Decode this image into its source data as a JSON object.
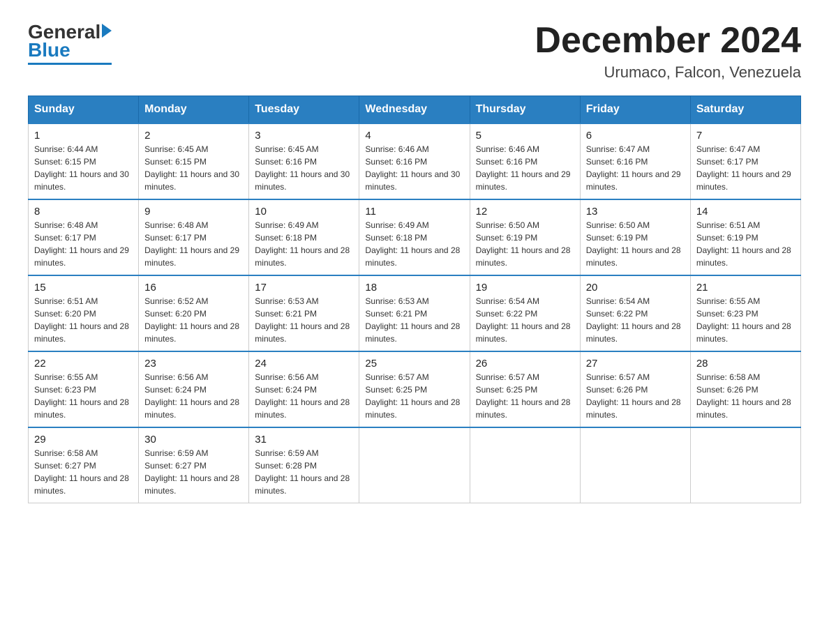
{
  "logo": {
    "general": "General",
    "blue": "Blue"
  },
  "title": "December 2024",
  "location": "Urumaco, Falcon, Venezuela",
  "headers": [
    "Sunday",
    "Monday",
    "Tuesday",
    "Wednesday",
    "Thursday",
    "Friday",
    "Saturday"
  ],
  "weeks": [
    [
      {
        "day": "1",
        "sunrise": "6:44 AM",
        "sunset": "6:15 PM",
        "daylight": "11 hours and 30 minutes."
      },
      {
        "day": "2",
        "sunrise": "6:45 AM",
        "sunset": "6:15 PM",
        "daylight": "11 hours and 30 minutes."
      },
      {
        "day": "3",
        "sunrise": "6:45 AM",
        "sunset": "6:16 PM",
        "daylight": "11 hours and 30 minutes."
      },
      {
        "day": "4",
        "sunrise": "6:46 AM",
        "sunset": "6:16 PM",
        "daylight": "11 hours and 30 minutes."
      },
      {
        "day": "5",
        "sunrise": "6:46 AM",
        "sunset": "6:16 PM",
        "daylight": "11 hours and 29 minutes."
      },
      {
        "day": "6",
        "sunrise": "6:47 AM",
        "sunset": "6:16 PM",
        "daylight": "11 hours and 29 minutes."
      },
      {
        "day": "7",
        "sunrise": "6:47 AM",
        "sunset": "6:17 PM",
        "daylight": "11 hours and 29 minutes."
      }
    ],
    [
      {
        "day": "8",
        "sunrise": "6:48 AM",
        "sunset": "6:17 PM",
        "daylight": "11 hours and 29 minutes."
      },
      {
        "day": "9",
        "sunrise": "6:48 AM",
        "sunset": "6:17 PM",
        "daylight": "11 hours and 29 minutes."
      },
      {
        "day": "10",
        "sunrise": "6:49 AM",
        "sunset": "6:18 PM",
        "daylight": "11 hours and 28 minutes."
      },
      {
        "day": "11",
        "sunrise": "6:49 AM",
        "sunset": "6:18 PM",
        "daylight": "11 hours and 28 minutes."
      },
      {
        "day": "12",
        "sunrise": "6:50 AM",
        "sunset": "6:19 PM",
        "daylight": "11 hours and 28 minutes."
      },
      {
        "day": "13",
        "sunrise": "6:50 AM",
        "sunset": "6:19 PM",
        "daylight": "11 hours and 28 minutes."
      },
      {
        "day": "14",
        "sunrise": "6:51 AM",
        "sunset": "6:19 PM",
        "daylight": "11 hours and 28 minutes."
      }
    ],
    [
      {
        "day": "15",
        "sunrise": "6:51 AM",
        "sunset": "6:20 PM",
        "daylight": "11 hours and 28 minutes."
      },
      {
        "day": "16",
        "sunrise": "6:52 AM",
        "sunset": "6:20 PM",
        "daylight": "11 hours and 28 minutes."
      },
      {
        "day": "17",
        "sunrise": "6:53 AM",
        "sunset": "6:21 PM",
        "daylight": "11 hours and 28 minutes."
      },
      {
        "day": "18",
        "sunrise": "6:53 AM",
        "sunset": "6:21 PM",
        "daylight": "11 hours and 28 minutes."
      },
      {
        "day": "19",
        "sunrise": "6:54 AM",
        "sunset": "6:22 PM",
        "daylight": "11 hours and 28 minutes."
      },
      {
        "day": "20",
        "sunrise": "6:54 AM",
        "sunset": "6:22 PM",
        "daylight": "11 hours and 28 minutes."
      },
      {
        "day": "21",
        "sunrise": "6:55 AM",
        "sunset": "6:23 PM",
        "daylight": "11 hours and 28 minutes."
      }
    ],
    [
      {
        "day": "22",
        "sunrise": "6:55 AM",
        "sunset": "6:23 PM",
        "daylight": "11 hours and 28 minutes."
      },
      {
        "day": "23",
        "sunrise": "6:56 AM",
        "sunset": "6:24 PM",
        "daylight": "11 hours and 28 minutes."
      },
      {
        "day": "24",
        "sunrise": "6:56 AM",
        "sunset": "6:24 PM",
        "daylight": "11 hours and 28 minutes."
      },
      {
        "day": "25",
        "sunrise": "6:57 AM",
        "sunset": "6:25 PM",
        "daylight": "11 hours and 28 minutes."
      },
      {
        "day": "26",
        "sunrise": "6:57 AM",
        "sunset": "6:25 PM",
        "daylight": "11 hours and 28 minutes."
      },
      {
        "day": "27",
        "sunrise": "6:57 AM",
        "sunset": "6:26 PM",
        "daylight": "11 hours and 28 minutes."
      },
      {
        "day": "28",
        "sunrise": "6:58 AM",
        "sunset": "6:26 PM",
        "daylight": "11 hours and 28 minutes."
      }
    ],
    [
      {
        "day": "29",
        "sunrise": "6:58 AM",
        "sunset": "6:27 PM",
        "daylight": "11 hours and 28 minutes."
      },
      {
        "day": "30",
        "sunrise": "6:59 AM",
        "sunset": "6:27 PM",
        "daylight": "11 hours and 28 minutes."
      },
      {
        "day": "31",
        "sunrise": "6:59 AM",
        "sunset": "6:28 PM",
        "daylight": "11 hours and 28 minutes."
      },
      null,
      null,
      null,
      null
    ]
  ]
}
